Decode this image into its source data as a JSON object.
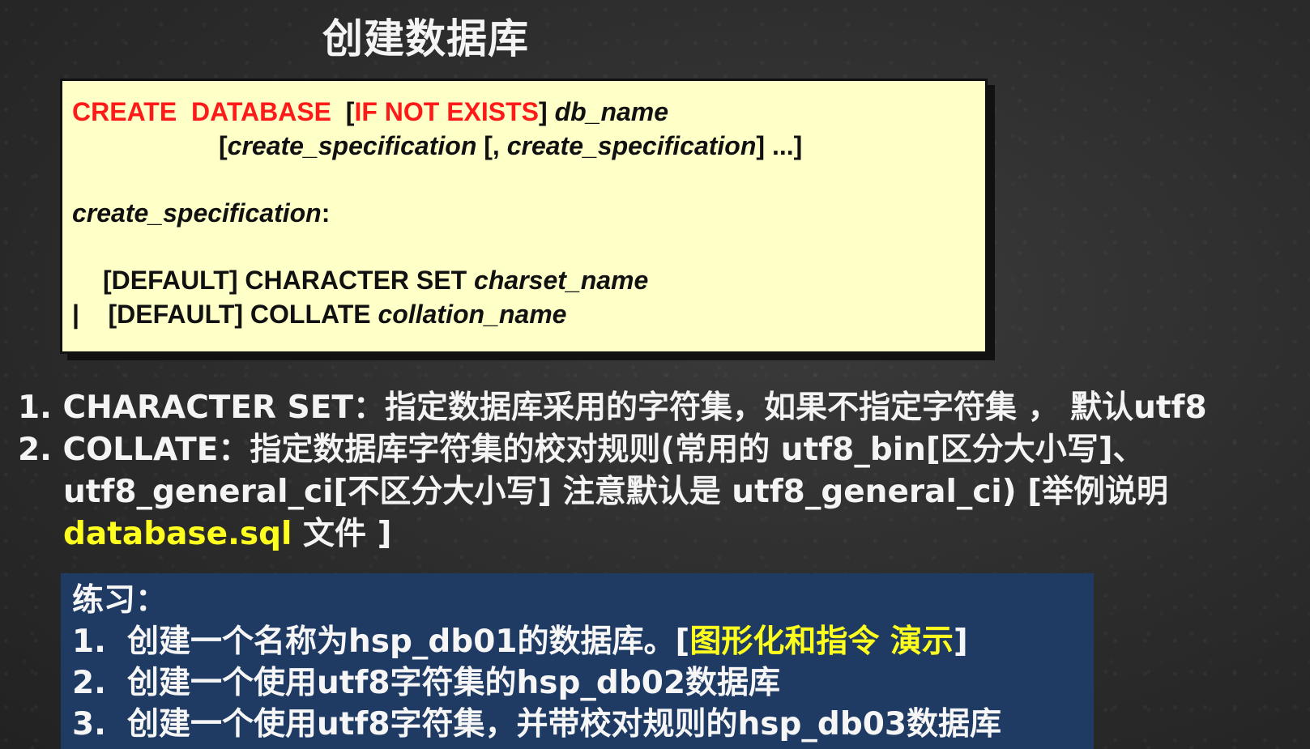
{
  "title": "创建数据库",
  "syntax": {
    "kw_create": "CREATE",
    "kw_database": "DATABASE",
    "bracket_open": "[",
    "kw_if_not_exists": "IF NOT EXISTS",
    "bracket_close": "]",
    "db_name": "db_name",
    "line2_open": "[",
    "spec1": "create_specification",
    "line2_mid": " [, ",
    "spec2": "create_specification",
    "line2_close": "] ...]",
    "spec_label": "create_specification",
    "spec_colon": ":",
    "opt1_prefix": "[DEFAULT] CHARACTER SET ",
    "opt1_value": "charset_name",
    "pipe": "|",
    "opt2_prefix": "[DEFAULT] COLLATE ",
    "opt2_value": "collation_name"
  },
  "notes": {
    "item1": "1. CHARACTER SET：指定数据库采用的字符集，如果不指定字符集 ， 默认utf8",
    "item2_line1": "2. COLLATE：指定数据库字符集的校对规则(常用的 utf8_bin[区分大小写]、",
    "item2_line2": "utf8_general_ci[不区分大小写] 注意默认是 utf8_general_ci) [举例说明",
    "item2_file": "database.sql",
    "item2_tail": " 文件 ]"
  },
  "exercise": {
    "heading": "练习：",
    "items": [
      {
        "num": "1.",
        "text": "创建一个名称为hsp_db01的数据库。[",
        "highlight": "图形化和指令 演示",
        "tail": "]"
      },
      {
        "num": "2.",
        "text": "创建一个使用utf8字符集的hsp_db02数据库"
      },
      {
        "num": "3.",
        "text": "创建一个使用utf8字符集，并带校对规则的hsp_db03数据库"
      }
    ]
  },
  "colors": {
    "keyword": "#ff1a1a",
    "syntax_background": "#ffffc8",
    "highlight": "#ffff1f",
    "exercise_background": "#1f3b63",
    "board": "#2c2c2c"
  }
}
